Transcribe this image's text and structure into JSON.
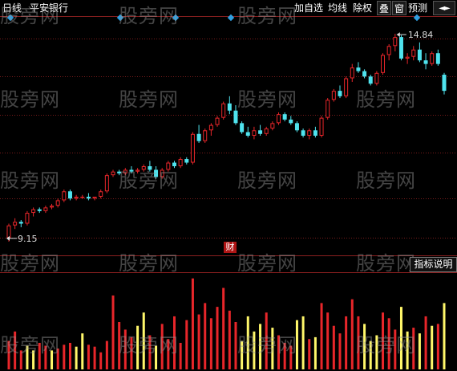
{
  "toolbar": {
    "tab_daily": "日线",
    "stock_name": "平安银行",
    "add_watch": "加自选",
    "ma_line": "均线",
    "ex_right": "除权",
    "overlay": "叠",
    "window": "窗",
    "forecast": "预测",
    "nav_arrows": "◄►"
  },
  "indicator_button": "指标说明",
  "financial_marker": "财",
  "watermark_text": "股旁网",
  "colors": {
    "background": "#000000",
    "up": "#e8262a",
    "down": "#4fe3ee",
    "volume_yellow": "#fff76a",
    "grid": "#7a1b1b",
    "diamond": "#2f9fe0"
  },
  "chart_data": {
    "type": "candlestick",
    "price_labels": {
      "high": "14.84",
      "low": "9.15"
    },
    "high_price": 14.84,
    "low_price": 9.15,
    "candles": [
      [
        9.15,
        9.55,
        9.05,
        9.5
      ],
      [
        9.5,
        9.7,
        9.4,
        9.6
      ],
      [
        9.6,
        9.65,
        9.45,
        9.55
      ],
      [
        9.55,
        9.9,
        9.5,
        9.85
      ],
      [
        9.85,
        10.0,
        9.75,
        9.95
      ],
      [
        9.95,
        10.0,
        9.85,
        9.9
      ],
      [
        9.9,
        10.05,
        9.85,
        10.0
      ],
      [
        10.0,
        10.1,
        9.95,
        10.05
      ],
      [
        10.05,
        10.25,
        10.0,
        10.2
      ],
      [
        10.2,
        10.5,
        10.15,
        10.45
      ],
      [
        10.45,
        10.5,
        10.2,
        10.25
      ],
      [
        10.25,
        10.35,
        10.2,
        10.3
      ],
      [
        10.3,
        10.35,
        10.25,
        10.3
      ],
      [
        10.3,
        10.4,
        10.2,
        10.25
      ],
      [
        10.25,
        10.3,
        10.2,
        10.3
      ],
      [
        10.3,
        10.5,
        10.25,
        10.45
      ],
      [
        10.45,
        10.95,
        10.4,
        10.9
      ],
      [
        10.9,
        11.05,
        10.85,
        11.0
      ],
      [
        11.0,
        11.05,
        10.9,
        10.95
      ],
      [
        10.95,
        11.1,
        10.9,
        11.05
      ],
      [
        11.05,
        11.15,
        10.95,
        11.0
      ],
      [
        11.0,
        11.1,
        10.95,
        11.05
      ],
      [
        11.05,
        11.2,
        11.0,
        11.15
      ],
      [
        11.15,
        11.3,
        11.0,
        11.05
      ],
      [
        11.05,
        11.15,
        10.8,
        10.85
      ],
      [
        10.85,
        11.1,
        10.8,
        11.05
      ],
      [
        11.05,
        11.3,
        11.0,
        11.25
      ],
      [
        11.25,
        11.3,
        11.1,
        11.15
      ],
      [
        11.15,
        11.4,
        11.1,
        11.35
      ],
      [
        11.35,
        11.4,
        11.2,
        11.25
      ],
      [
        11.25,
        12.1,
        11.2,
        12.05
      ],
      [
        12.05,
        12.3,
        11.8,
        11.85
      ],
      [
        11.85,
        12.2,
        11.8,
        12.15
      ],
      [
        12.15,
        12.35,
        12.0,
        12.3
      ],
      [
        12.3,
        12.55,
        12.25,
        12.5
      ],
      [
        12.5,
        12.95,
        12.45,
        12.9
      ],
      [
        12.9,
        13.1,
        12.6,
        12.7
      ],
      [
        12.7,
        12.85,
        12.3,
        12.35
      ],
      [
        12.35,
        12.4,
        12.05,
        12.1
      ],
      [
        12.1,
        12.25,
        11.95,
        12.0
      ],
      [
        12.0,
        12.25,
        11.9,
        12.15
      ],
      [
        12.15,
        12.3,
        12.0,
        12.05
      ],
      [
        12.05,
        12.25,
        12.0,
        12.2
      ],
      [
        12.2,
        12.4,
        12.15,
        12.35
      ],
      [
        12.35,
        12.65,
        12.3,
        12.6
      ],
      [
        12.6,
        12.65,
        12.4,
        12.45
      ],
      [
        12.45,
        12.55,
        12.3,
        12.35
      ],
      [
        12.35,
        12.4,
        12.1,
        12.15
      ],
      [
        12.15,
        12.2,
        11.95,
        12.0
      ],
      [
        12.0,
        12.2,
        11.9,
        12.15
      ],
      [
        12.15,
        12.25,
        11.95,
        12.0
      ],
      [
        12.0,
        12.55,
        11.95,
        12.5
      ],
      [
        12.5,
        13.05,
        12.45,
        13.0
      ],
      [
        13.0,
        13.3,
        12.95,
        13.25
      ],
      [
        13.25,
        13.4,
        13.05,
        13.1
      ],
      [
        13.1,
        13.65,
        13.05,
        13.6
      ],
      [
        13.6,
        14.0,
        13.5,
        13.9
      ],
      [
        13.9,
        14.05,
        13.75,
        13.8
      ],
      [
        13.8,
        13.85,
        13.6,
        13.65
      ],
      [
        13.65,
        13.7,
        13.4,
        13.45
      ],
      [
        13.45,
        13.8,
        13.4,
        13.75
      ],
      [
        13.75,
        14.3,
        13.7,
        14.25
      ],
      [
        14.25,
        14.55,
        14.1,
        14.5
      ],
      [
        14.5,
        14.84,
        14.35,
        14.75
      ],
      [
        14.75,
        14.8,
        14.1,
        14.15
      ],
      [
        14.15,
        14.3,
        14.0,
        14.2
      ],
      [
        14.2,
        14.5,
        14.1,
        14.4
      ],
      [
        14.4,
        14.6,
        14.05,
        14.1
      ],
      [
        14.1,
        14.3,
        13.85,
        14.0
      ],
      [
        14.0,
        14.35,
        13.95,
        14.3
      ],
      [
        14.3,
        14.4,
        13.95,
        14.0
      ],
      [
        13.7,
        13.75,
        13.15,
        13.25
      ]
    ],
    "volume_max": 100,
    "volumes": [
      [
        30,
        "r"
      ],
      [
        40,
        "r"
      ],
      [
        20,
        "r"
      ],
      [
        25,
        "y"
      ],
      [
        20,
        "y"
      ],
      [
        28,
        "r"
      ],
      [
        25,
        "r"
      ],
      [
        20,
        "y"
      ],
      [
        22,
        "r"
      ],
      [
        26,
        "r"
      ],
      [
        28,
        "r"
      ],
      [
        24,
        "y"
      ],
      [
        38,
        "y"
      ],
      [
        26,
        "r"
      ],
      [
        24,
        "r"
      ],
      [
        18,
        "r"
      ],
      [
        30,
        "r"
      ],
      [
        78,
        "r"
      ],
      [
        50,
        "r"
      ],
      [
        42,
        "r"
      ],
      [
        34,
        "r"
      ],
      [
        46,
        "y"
      ],
      [
        60,
        "y"
      ],
      [
        36,
        "r"
      ],
      [
        25,
        "y"
      ],
      [
        48,
        "r"
      ],
      [
        32,
        "r"
      ],
      [
        56,
        "r"
      ],
      [
        28,
        "r"
      ],
      [
        52,
        "r"
      ],
      [
        96,
        "r"
      ],
      [
        58,
        "r"
      ],
      [
        70,
        "r"
      ],
      [
        54,
        "r"
      ],
      [
        66,
        "r"
      ],
      [
        86,
        "r"
      ],
      [
        62,
        "r"
      ],
      [
        50,
        "r"
      ],
      [
        30,
        "y"
      ],
      [
        56,
        "y"
      ],
      [
        40,
        "y"
      ],
      [
        48,
        "y"
      ],
      [
        60,
        "r"
      ],
      [
        44,
        "y"
      ],
      [
        36,
        "r"
      ],
      [
        28,
        "r"
      ],
      [
        25,
        "r"
      ],
      [
        52,
        "y"
      ],
      [
        56,
        "y"
      ],
      [
        32,
        "r"
      ],
      [
        34,
        "y"
      ],
      [
        70,
        "r"
      ],
      [
        60,
        "r"
      ],
      [
        46,
        "r"
      ],
      [
        38,
        "r"
      ],
      [
        56,
        "r"
      ],
      [
        74,
        "r"
      ],
      [
        56,
        "r"
      ],
      [
        48,
        "y"
      ],
      [
        30,
        "y"
      ],
      [
        36,
        "y"
      ],
      [
        60,
        "r"
      ],
      [
        54,
        "r"
      ],
      [
        42,
        "r"
      ],
      [
        66,
        "y"
      ],
      [
        40,
        "y"
      ],
      [
        44,
        "r"
      ],
      [
        38,
        "y"
      ],
      [
        56,
        "r"
      ],
      [
        46,
        "y"
      ],
      [
        48,
        "r"
      ],
      [
        70,
        "y"
      ]
    ]
  }
}
